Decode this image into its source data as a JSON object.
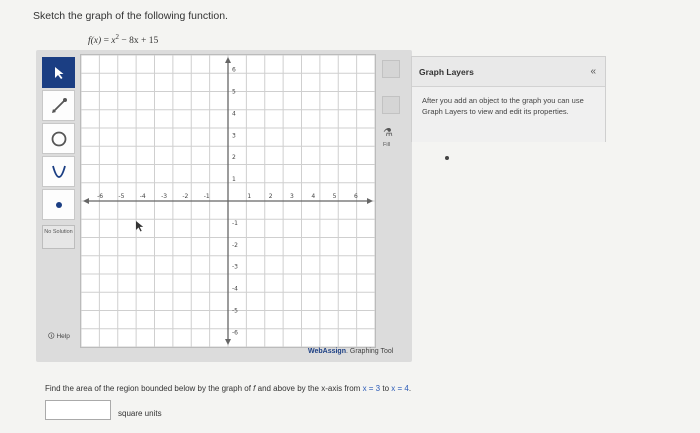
{
  "prompt": "Sketch the graph of the following function.",
  "function": {
    "lhs": "f(x)",
    "eq": " = ",
    "x": "x",
    "exp": "2",
    "rest": " − 8x + 15"
  },
  "toolbar": {
    "tools": [
      "pointer-icon",
      "line-icon",
      "circle-icon",
      "parabola-icon",
      "point-icon"
    ],
    "no_solution": "No Solution",
    "help": "Help"
  },
  "graph": {
    "x_labels": [
      "-6",
      "-5",
      "-4",
      "-3",
      "-2",
      "-1",
      "1",
      "2",
      "3",
      "4",
      "5",
      "6"
    ],
    "y_labels": [
      "6",
      "5",
      "4",
      "3",
      "2",
      "1",
      "-1",
      "-2",
      "-3",
      "-4",
      "-5",
      "-6"
    ],
    "fill_label": "Fill"
  },
  "brand": {
    "web": "WebAssign",
    "rest": ". Graphing Tool"
  },
  "layers": {
    "title": "Graph Layers",
    "collapse": "«",
    "text": "After you add an object to the graph you can use Graph Layers to view and edit its properties."
  },
  "question": {
    "part1": "Find the area of the region bounded below by the graph of ",
    "f": "f",
    "part2": " and above by the x-axis from ",
    "x1": "x = 3",
    "to": " to ",
    "x2": "x = 4",
    "end": "."
  },
  "answer": {
    "value": "",
    "units": "square units"
  },
  "colors": {
    "accent": "#1b3e83",
    "blue_text": "#2b5bb8"
  }
}
